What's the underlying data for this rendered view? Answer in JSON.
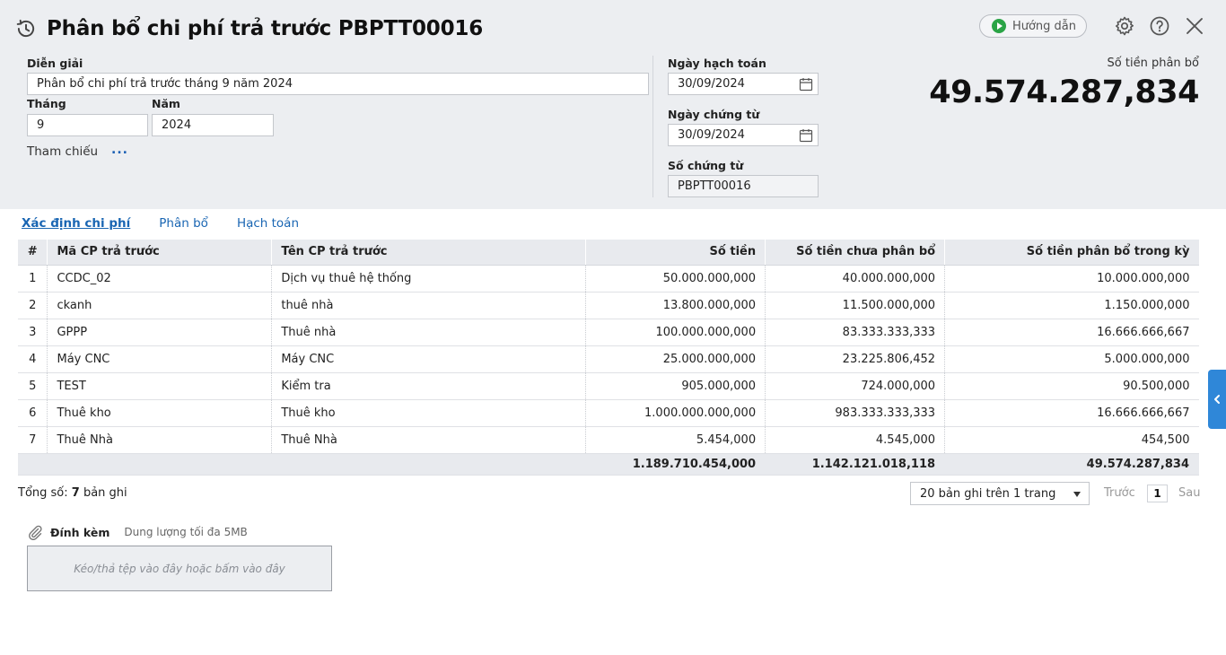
{
  "header": {
    "title": "Phân bổ chi phí trả trước PBPTT00016",
    "guide_label": "Hướng dẫn",
    "icons": {
      "history": "history-icon",
      "settings": "gear-icon",
      "help": "help-icon",
      "close": "close-icon"
    }
  },
  "form": {
    "description_label": "Diễn giải",
    "description_value": "Phân bổ chi phí trả trước tháng 9 năm 2024",
    "month_label": "Tháng",
    "month_value": "9",
    "year_label": "Năm",
    "year_value": "2024",
    "reference_label": "Tham chiếu",
    "reference_link": "...",
    "posting_date_label": "Ngày hạch toán",
    "posting_date_value": "30/09/2024",
    "voucher_date_label": "Ngày chứng từ",
    "voucher_date_value": "30/09/2024",
    "voucher_no_label": "Số chứng từ",
    "voucher_no_value": "PBPTT00016",
    "amount_label": "Số tiền phân bổ",
    "amount_value": "49.574.287,834"
  },
  "tabs": [
    {
      "label": "Xác định chi phí",
      "active": true
    },
    {
      "label": "Phân bổ",
      "active": false
    },
    {
      "label": "Hạch toán",
      "active": false
    }
  ],
  "table": {
    "columns": [
      "#",
      "Mã CP trả trước",
      "Tên CP trả trước",
      "Số tiền",
      "Số tiền chưa phân bổ",
      "Số tiền phân bổ trong kỳ"
    ],
    "rows": [
      [
        "1",
        "CCDC_02",
        "Dịch vụ thuê hệ thống",
        "50.000.000,000",
        "40.000.000,000",
        "10.000.000,000"
      ],
      [
        "2",
        "ckanh",
        "thuê nhà",
        "13.800.000,000",
        "11.500.000,000",
        "1.150.000,000"
      ],
      [
        "3",
        "GPPP",
        "Thuê nhà",
        "100.000.000,000",
        "83.333.333,333",
        "16.666.666,667"
      ],
      [
        "4",
        "Máy CNC",
        "Máy CNC",
        "25.000.000,000",
        "23.225.806,452",
        "5.000.000,000"
      ],
      [
        "5",
        "TEST",
        "Kiểm tra",
        "905.000,000",
        "724.000,000",
        "90.500,000"
      ],
      [
        "6",
        "Thuê kho",
        "Thuê kho",
        "1.000.000.000,000",
        "983.333.333,333",
        "16.666.666,667"
      ],
      [
        "7",
        "Thuê Nhà",
        "Thuê Nhà",
        "5.454,000",
        "4.545,000",
        "454,500"
      ]
    ],
    "totals": {
      "amount": "1.189.710.454,000",
      "unallocated": "1.142.121.018,118",
      "allocated": "49.574.287,834"
    }
  },
  "footer": {
    "total_prefix": "Tổng số: ",
    "total_count": "7",
    "total_suffix": " bản ghi",
    "page_size": "20 bản ghi trên 1 trang",
    "prev_label": "Trước",
    "current_page": "1",
    "next_label": "Sau"
  },
  "attachment": {
    "title": "Đính kèm",
    "hint": "Dung lượng tối đa 5MB",
    "dropzone_text": "Kéo/thả tệp vào đây hoặc bấm vào đây"
  },
  "colors": {
    "header_bg": "#eceef1",
    "accent": "#1a66b3",
    "side_tab": "#2f87d8",
    "guide_play": "#2aa446"
  }
}
